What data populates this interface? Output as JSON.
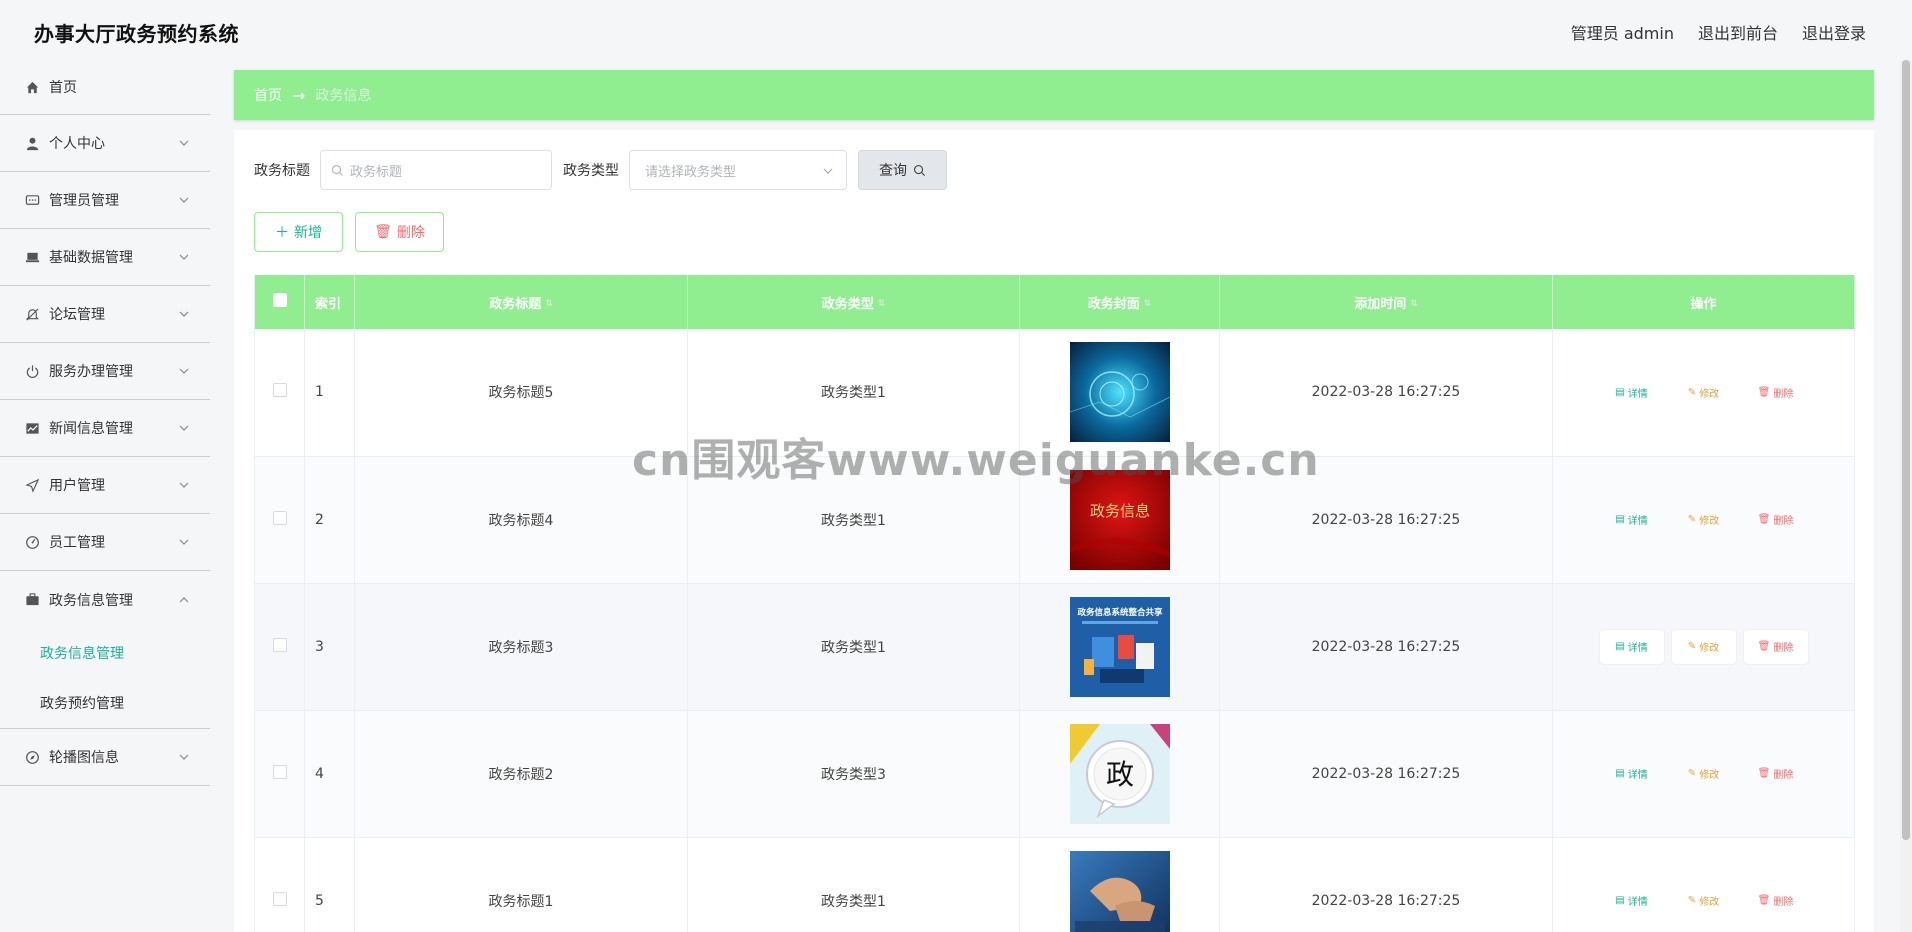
{
  "header": {
    "title": "办事大厅政务预约系统",
    "user_label": "管理员 admin",
    "back_front": "退出到前台",
    "logout": "退出登录"
  },
  "sidebar": {
    "items": [
      {
        "label": "首页",
        "icon": "home-icon"
      },
      {
        "label": "个人中心",
        "icon": "user-icon"
      },
      {
        "label": "管理员管理",
        "icon": "chat-icon"
      },
      {
        "label": "基础数据管理",
        "icon": "laptop-icon"
      },
      {
        "label": "论坛管理",
        "icon": "bell-off-icon"
      },
      {
        "label": "服务办理管理",
        "icon": "power-icon"
      },
      {
        "label": "新闻信息管理",
        "icon": "chart-icon"
      },
      {
        "label": "用户管理",
        "icon": "send-icon"
      },
      {
        "label": "员工管理",
        "icon": "gauge-icon"
      },
      {
        "label": "政务信息管理",
        "icon": "briefcase-icon"
      },
      {
        "label": "轮播图信息",
        "icon": "compass-icon"
      }
    ],
    "submenu": {
      "active": "政务信息管理",
      "other": "政务预约管理"
    }
  },
  "breadcrumb": {
    "home": "首页",
    "current": "政务信息"
  },
  "search": {
    "title_label": "政务标题",
    "title_placeholder": "政务标题",
    "type_label": "政务类型",
    "type_placeholder": "请选择政务类型",
    "query_label": "查询"
  },
  "actions": {
    "add_label": "新增",
    "delete_label": "删除"
  },
  "table": {
    "columns": [
      "索引",
      "政务标题",
      "政务类型",
      "政务封面",
      "添加时间",
      "操作"
    ],
    "rows": [
      {
        "index": "1",
        "title": "政务标题5",
        "type": "政务类型1",
        "time": "2022-03-28 16:27:25",
        "cover": "digital-tech-cover"
      },
      {
        "index": "2",
        "title": "政务标题4",
        "type": "政务类型1",
        "time": "2022-03-28 16:27:25",
        "cover": "red-info-cover",
        "cover_text": "政务信息"
      },
      {
        "index": "3",
        "title": "政务标题3",
        "type": "政务类型1",
        "time": "2022-03-28 16:27:25",
        "cover": "blue-poster-cover",
        "cover_text": "政务信息系统整合共享"
      },
      {
        "index": "4",
        "title": "政务标题2",
        "type": "政务类型3",
        "time": "2022-03-28 16:27:25",
        "cover": "bubble-cover",
        "cover_text": "政"
      },
      {
        "index": "5",
        "title": "政务标题1",
        "type": "政务类型1",
        "time": "2022-03-28 16:27:25",
        "cover": "keyboard-cover"
      }
    ],
    "op_detail": "详情",
    "op_edit": "修改",
    "op_delete": "删除"
  },
  "watermark": "cn围观客www.weiguanke.cn",
  "colors": {
    "accent_green": "#90ee90",
    "teal": "#1ab394",
    "orange": "#e6a23c",
    "red": "#f56c6c"
  }
}
